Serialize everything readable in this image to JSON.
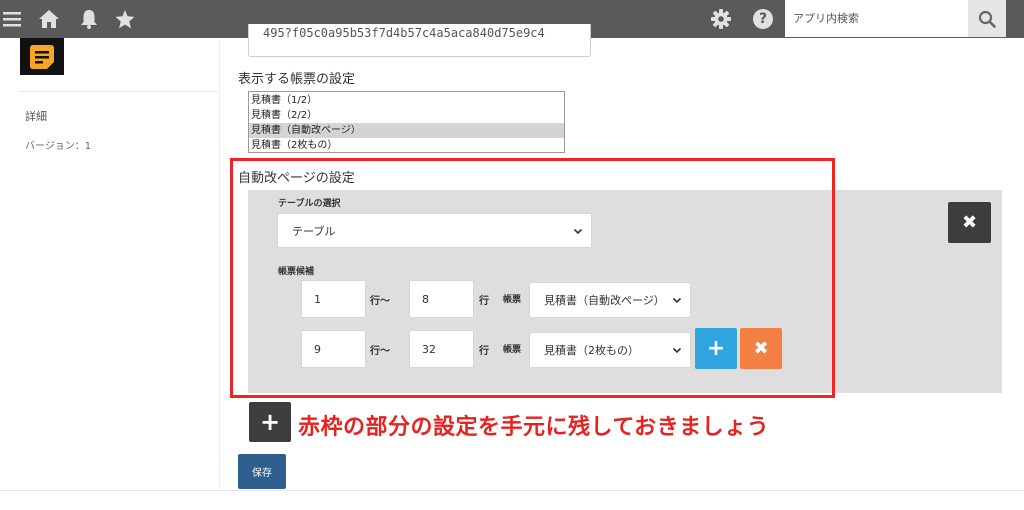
{
  "header": {
    "search_placeholder": "アプリ内検索"
  },
  "sidebar": {
    "detail_label": "詳細",
    "version_label": "バージョン：1"
  },
  "main": {
    "top_field_value": "495?f05c0a95b53f7d4b57c4a5aca840d75e9c4",
    "display_section_title": "表示する帳票の設定",
    "display_options": [
      "見積書（1/2）",
      "見積書（2/2）",
      "見積書（自動改ページ）",
      "見積書（2枚もの）"
    ],
    "display_selected_index": 2,
    "auto_section_title": "自動改ページの設定",
    "table_select_label": "テーブルの選択",
    "table_select_value": "テーブル",
    "candidate_label": "帳票候補",
    "rows": [
      {
        "from": "1",
        "from_unit": "行～",
        "to": "8",
        "to_unit": "行",
        "doc_label": "帳票",
        "doc_value": "見積書（自動改ページ）"
      },
      {
        "from": "9",
        "from_unit": "行～",
        "to": "32",
        "to_unit": "行",
        "doc_label": "帳票",
        "doc_value": "見積書（2枚もの）"
      }
    ],
    "annotation": "赤枠の部分の設定を手元に残しておきましょう",
    "save_label": "保存"
  },
  "colors": {
    "topbar": "#5a5a5a",
    "panel": "#dedede",
    "add_row_button": "#2fa4e0",
    "delete_row_button": "#f47f42",
    "dark_button": "#3d3d3d",
    "save_button": "#2f5f8f",
    "annotation_red": "#ee2525"
  }
}
